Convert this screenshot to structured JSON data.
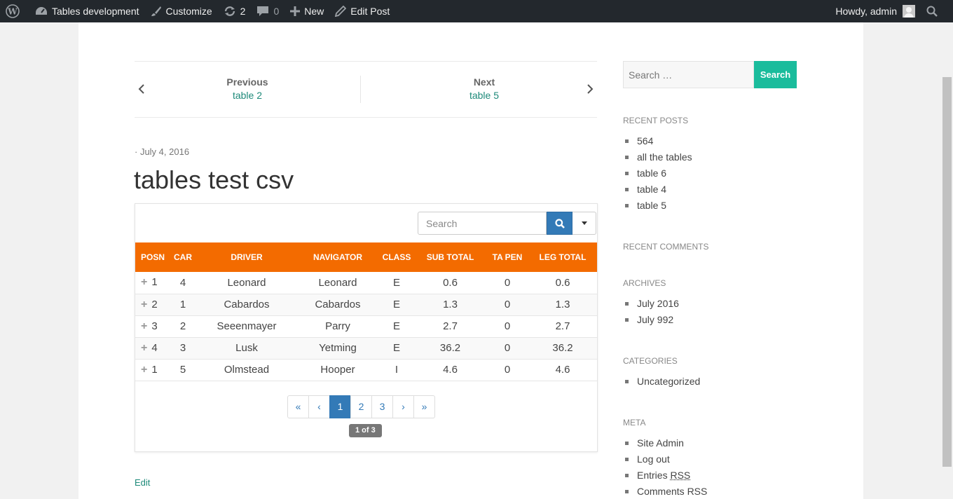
{
  "adminbar": {
    "site_name": "Tables development",
    "customize": "Customize",
    "updates_count": "2",
    "comments_count": "0",
    "new_label": "New",
    "edit_post": "Edit Post",
    "howdy": "Howdy, admin"
  },
  "postnav": {
    "prev_label": "Previous",
    "prev_title": "table 2",
    "next_label": "Next",
    "next_title": "table 5"
  },
  "post": {
    "date": "· July 4, 2016",
    "title": "tables test csv",
    "edit_link": "Edit"
  },
  "table": {
    "search_placeholder": "Search",
    "headers": [
      "POSN",
      "CAR",
      "DRIVER",
      "NAVIGATOR",
      "CLASS",
      "SUB TOTAL",
      "TA PEN",
      "LEG TOTAL"
    ],
    "rows": [
      [
        "1",
        "4",
        "Leonard",
        "Leonard",
        "E",
        "0.6",
        "0",
        "0.6"
      ],
      [
        "2",
        "1",
        "Cabardos",
        "Cabardos",
        "E",
        "1.3",
        "0",
        "1.3"
      ],
      [
        "3",
        "2",
        "Seeenmayer",
        "Parry",
        "E",
        "2.7",
        "0",
        "2.7"
      ],
      [
        "4",
        "3",
        "Lusk",
        "Yetming",
        "E",
        "36.2",
        "0",
        "36.2"
      ],
      [
        "1",
        "5",
        "Olmstead",
        "Hooper",
        "I",
        "4.6",
        "0",
        "4.6"
      ]
    ],
    "header_color": "#f36b00"
  },
  "pagination": {
    "first": "«",
    "prev": "‹",
    "pages": [
      "1",
      "2",
      "3"
    ],
    "next": "›",
    "last": "»",
    "current": "1",
    "count_label": "1 of 3"
  },
  "sidebar": {
    "search_placeholder": "Search …",
    "search_button": "Search",
    "recent_posts_title": "RECENT POSTS",
    "recent_posts": [
      "564",
      "all the tables",
      "table 6",
      "table 4",
      "table 5"
    ],
    "recent_comments_title": "RECENT COMMENTS",
    "archives_title": "ARCHIVES",
    "archives": [
      "July 2016",
      "July 992"
    ],
    "categories_title": "CATEGORIES",
    "categories": [
      "Uncategorized"
    ],
    "meta_title": "META",
    "meta": {
      "site_admin": "Site Admin",
      "log_out": "Log out",
      "entries_prefix": "Entries",
      "entries_abbr": "RSS",
      "comments_rss": "Comments RSS"
    }
  },
  "colors": {
    "accent_link": "#1e8a7a",
    "search_button": "#1abc9c",
    "primary_blue": "#337ab7"
  }
}
